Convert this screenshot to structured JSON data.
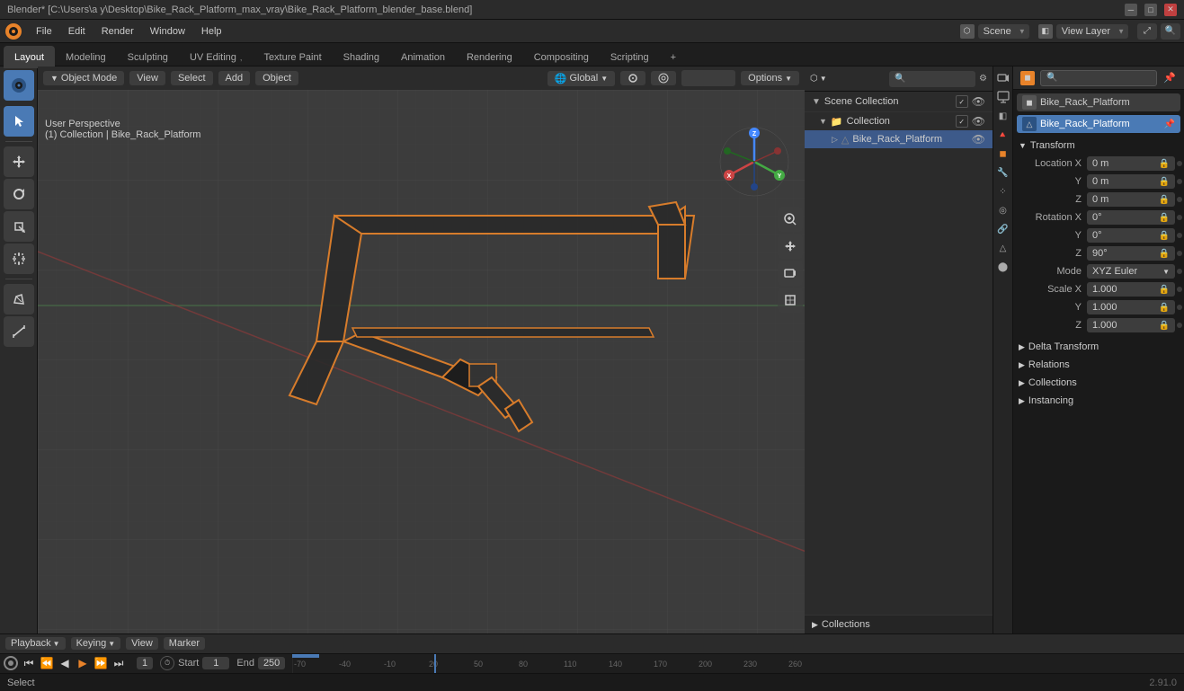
{
  "titlebar": {
    "title": "Blender* [C:\\Users\\a y\\Desktop\\Bike_Rack_Platform_max_vray\\Bike_Rack_Platform_blender_base.blend]",
    "min_label": "─",
    "max_label": "□",
    "close_label": "✕"
  },
  "menubar": {
    "items": [
      "Blender",
      "File",
      "Edit",
      "Render",
      "Window",
      "Help"
    ]
  },
  "workspace_tabs": {
    "tabs": [
      "Layout",
      "Modeling",
      "Sculpting",
      "UV Editing",
      "Texture Paint",
      "Shading",
      "Animation",
      "Rendering",
      "Compositing",
      "Scripting"
    ],
    "active": "Layout",
    "extra_btn": "+"
  },
  "viewport_header": {
    "mode": "Object Mode",
    "view_label": "View",
    "select_label": "Select",
    "add_label": "Add",
    "object_label": "Object",
    "transform": "Global",
    "snap_label": "",
    "proportional_label": "",
    "options_label": "Options"
  },
  "viewport_info": {
    "perspective": "User Perspective",
    "collection_info": "(1) Collection | Bike_Rack_Platform"
  },
  "scene_selector": {
    "label": "Scene"
  },
  "view_layer": {
    "label": "View Layer"
  },
  "outliner": {
    "header": "Scene Collection",
    "items": [
      {
        "label": "Collection",
        "level": 0,
        "icon": "▼",
        "visible": true,
        "has_checkbox": true
      },
      {
        "label": "Bike_Rack_Platform",
        "level": 1,
        "icon": "▷",
        "visible": true,
        "selected": true
      }
    ]
  },
  "properties": {
    "search_placeholder": "Search...",
    "object_name": "Bike_Rack_Platform",
    "object_data_name": "Bike_Rack_Platform",
    "transform_label": "Transform",
    "location": {
      "x": "0 m",
      "y": "0 m",
      "z": "0 m"
    },
    "rotation": {
      "x": "0°",
      "y": "0°",
      "z": "90°",
      "mode": "XYZ Euler"
    },
    "scale": {
      "x": "1.000",
      "y": "1.000",
      "z": "1.000"
    },
    "delta_transform_label": "Delta Transform",
    "relations_label": "Relations",
    "collections_label": "Collections",
    "instancing_label": "Instancing"
  },
  "timeline": {
    "playback_label": "Playback",
    "keying_label": "Keying",
    "view_label": "View",
    "marker_label": "Marker",
    "frame_current": "1",
    "start_label": "Start",
    "start_value": "1",
    "end_label": "End",
    "end_value": "250",
    "dot_label": "●",
    "transport_buttons": [
      "⏮",
      "⏪",
      "◀",
      "▶",
      "⏩",
      "⏭"
    ]
  },
  "status_bar": {
    "left": "Select",
    "center": "",
    "right": "2.91.0"
  },
  "bottom_collections": {
    "label": "Collections"
  }
}
